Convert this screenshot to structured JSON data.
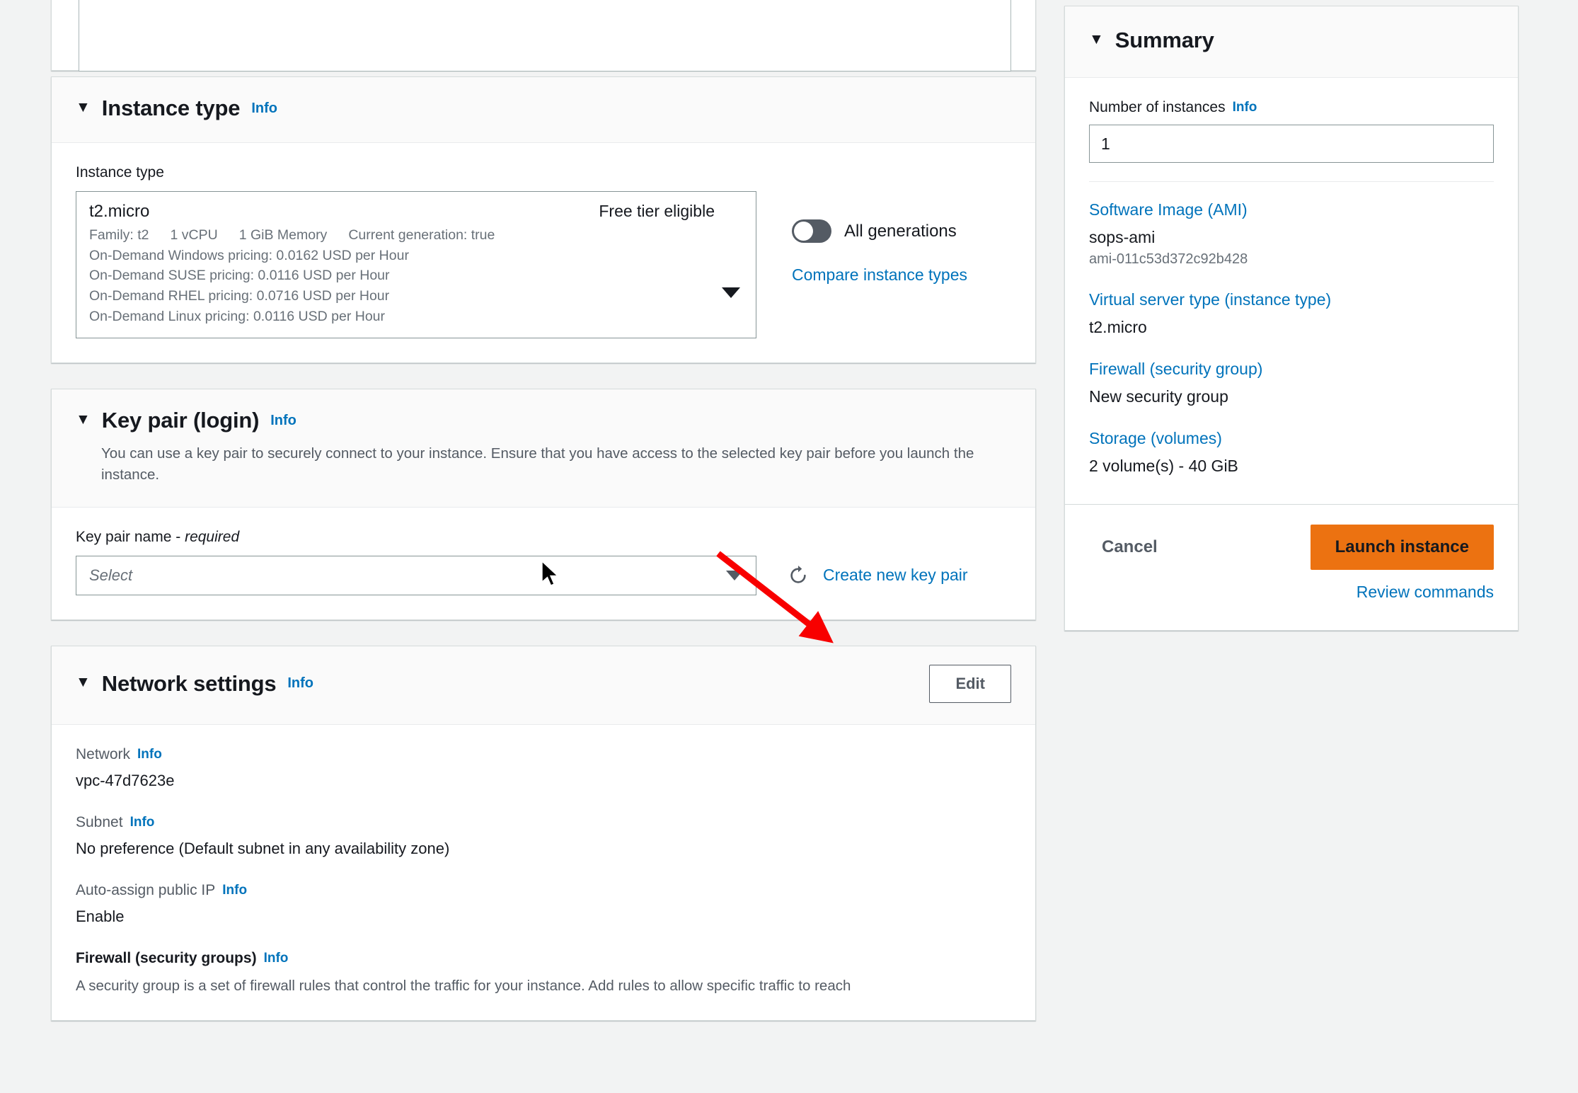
{
  "instance_type_section": {
    "title": "Instance type",
    "info_label": "Info",
    "field_label": "Instance type",
    "selected": {
      "name": "t2.micro",
      "free_tier_badge": "Free tier eligible",
      "family": "Family: t2",
      "vcpu": "1 vCPU",
      "memory": "1 GiB Memory",
      "generation": "Current generation: true",
      "pricing_windows": "On-Demand Windows pricing: 0.0162 USD per Hour",
      "pricing_suse": "On-Demand SUSE pricing: 0.0116 USD per Hour",
      "pricing_rhel": "On-Demand RHEL pricing: 0.0716 USD per Hour",
      "pricing_linux": "On-Demand Linux pricing: 0.0116 USD per Hour"
    },
    "all_generations_label": "All generations",
    "all_generations_on": false,
    "compare_link": "Compare instance types"
  },
  "key_pair_section": {
    "title": "Key pair (login)",
    "info_label": "Info",
    "description": "You can use a key pair to securely connect to your instance. Ensure that you have access to the selected key pair before you launch the instance.",
    "field_label": "Key pair name - ",
    "field_label_required": "required",
    "select_placeholder": "Select",
    "select_value": "",
    "create_link": "Create new key pair",
    "refresh_icon": "refresh-icon"
  },
  "network_section": {
    "title": "Network settings",
    "info_label": "Info",
    "edit_label": "Edit",
    "network_label": "Network",
    "network_value": "vpc-47d7623e",
    "subnet_label": "Subnet",
    "subnet_value": "No preference (Default subnet in any availability zone)",
    "auto_ip_label": "Auto-assign public IP",
    "auto_ip_value": "Enable",
    "firewall_label": "Firewall (security groups)",
    "firewall_desc": "A security group is a set of firewall rules that control the traffic for your instance. Add rules to allow specific traffic to reach"
  },
  "summary": {
    "title": "Summary",
    "num_instances_label": "Number of instances",
    "num_instances_info": "Info",
    "num_instances_value": "1",
    "ami_link": "Software Image (AMI)",
    "ami_name": "sops-ami",
    "ami_id": "ami-011c53d372c92b428",
    "instance_type_link": "Virtual server type (instance type)",
    "instance_type_value": "t2.micro",
    "firewall_link": "Firewall (security group)",
    "firewall_value": "New security group",
    "storage_link": "Storage (volumes)",
    "storage_value": "2 volume(s) - 40 GiB",
    "cancel_label": "Cancel",
    "launch_label": "Launch instance",
    "review_label": "Review commands"
  },
  "colors": {
    "accent_link": "#0073bb",
    "launch_button": "#ec7211",
    "page_bg": "#f2f3f3",
    "annotation_arrow": "#f80000"
  },
  "annotations": {
    "arrow_name": "red-arrow-pointing-to-create-new-key-pair",
    "cursor_name": "mouse-cursor"
  }
}
